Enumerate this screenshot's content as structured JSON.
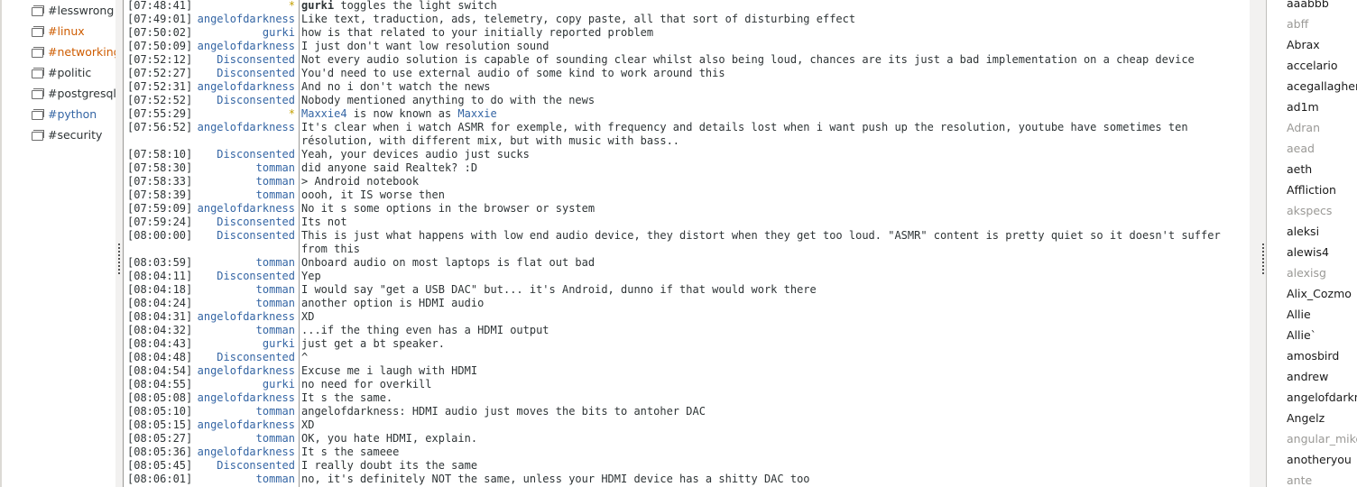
{
  "channels": [
    {
      "name": "#lesswrong",
      "state": "normal"
    },
    {
      "name": "#linux",
      "state": "highlight"
    },
    {
      "name": "#networking",
      "state": "highlight"
    },
    {
      "name": "#politic",
      "state": "normal"
    },
    {
      "name": "#postgresql",
      "state": "normal"
    },
    {
      "name": "#python",
      "state": "msg"
    },
    {
      "name": "#security",
      "state": "normal"
    }
  ],
  "messages": [
    {
      "time": "[07:48:41]",
      "nick": "*",
      "type": "action",
      "actor": "gurki",
      "text": " toggles the light switch"
    },
    {
      "time": "[07:49:01]",
      "nick": "angelofdarkness",
      "text": "Like text, traduction, ads, telemetry, copy paste, all that sort of disturbing effect"
    },
    {
      "time": "[07:50:02]",
      "nick": "gurki",
      "text": "how is that related to your initially reported problem"
    },
    {
      "time": "[07:50:09]",
      "nick": "angelofdarkness",
      "text": "I just don't want low resolution sound"
    },
    {
      "time": "[07:52:12]",
      "nick": "Disconsented",
      "text": "Not every audio solution is capable of sounding clear whilst also being loud, chances are its just a bad implementation on a cheap device"
    },
    {
      "time": "[07:52:27]",
      "nick": "Disconsented",
      "text": "You'd need to use external audio of some kind to work around this"
    },
    {
      "time": "[07:52:31]",
      "nick": "angelofdarkness",
      "text": "And no i don't watch the news"
    },
    {
      "time": "[07:52:52]",
      "nick": "Disconsented",
      "text": "Nobody mentioned anything to do with the news"
    },
    {
      "time": "[07:55:29]",
      "nick": "*",
      "type": "nickchange",
      "old": "Maxxie4",
      "mid": " is now known as ",
      "new": "Maxxie"
    },
    {
      "time": "[07:56:52]",
      "nick": "angelofdarkness",
      "text": "It's clear when i watch ASMR for exemple, with frequency and details lost when i want push up the resolution, youtube have sometimes ten résolution, with different mix, but with music with bass.."
    },
    {
      "time": "[07:58:10]",
      "nick": "Disconsented",
      "text": "Yeah, your devices audio just sucks"
    },
    {
      "time": "[07:58:30]",
      "nick": "tomman",
      "text": "did anyone said Realtek? :D"
    },
    {
      "time": "[07:58:33]",
      "nick": "tomman",
      "text": "> Android notebook"
    },
    {
      "time": "[07:58:39]",
      "nick": "tomman",
      "text": "oooh, it IS worse then"
    },
    {
      "time": "[07:59:09]",
      "nick": "angelofdarkness",
      "text": "No it s some options in the browser or system"
    },
    {
      "time": "[07:59:24]",
      "nick": "Disconsented",
      "text": "Its not"
    },
    {
      "time": "[08:00:00]",
      "nick": "Disconsented",
      "text": "This is just what happens with low end audio device, they distort when they get too loud. \"ASMR\" content is pretty quiet so it doesn't suffer from this"
    },
    {
      "time": "[08:03:59]",
      "nick": "tomman",
      "text": "Onboard audio on most laptops is flat out bad"
    },
    {
      "time": "[08:04:11]",
      "nick": "Disconsented",
      "text": "Yep"
    },
    {
      "time": "[08:04:18]",
      "nick": "tomman",
      "text": "I would say \"get a USB DAC\" but... it's Android, dunno if that would work there"
    },
    {
      "time": "[08:04:24]",
      "nick": "tomman",
      "text": "another option is HDMI audio"
    },
    {
      "time": "[08:04:31]",
      "nick": "angelofdarkness",
      "text": "XD"
    },
    {
      "time": "[08:04:32]",
      "nick": "tomman",
      "text": "...if the thing even has a HDMI output"
    },
    {
      "time": "[08:04:43]",
      "nick": "gurki",
      "text": "just get a bt speaker."
    },
    {
      "time": "[08:04:48]",
      "nick": "Disconsented",
      "text": "^"
    },
    {
      "time": "[08:04:54]",
      "nick": "angelofdarkness",
      "text": "Excuse me i laugh with HDMI"
    },
    {
      "time": "[08:04:55]",
      "nick": "gurki",
      "text": "no need for overkill"
    },
    {
      "time": "[08:05:08]",
      "nick": "angelofdarkness",
      "text": "It s the same."
    },
    {
      "time": "[08:05:10]",
      "nick": "tomman",
      "text": "angelofdarkness: HDMI audio just moves the bits to antoher DAC"
    },
    {
      "time": "[08:05:15]",
      "nick": "angelofdarkness",
      "text": "XD"
    },
    {
      "time": "[08:05:27]",
      "nick": "tomman",
      "text": "OK, you hate HDMI, explain."
    },
    {
      "time": "[08:05:36]",
      "nick": "angelofdarkness",
      "text": "It s the sameee"
    },
    {
      "time": "[08:05:45]",
      "nick": "Disconsented",
      "text": "I really doubt its the same"
    },
    {
      "time": "[08:06:01]",
      "nick": "tomman",
      "text": "no, it's definitely NOT the same, unless your HDMI device has a shitty DAC too"
    }
  ],
  "users": [
    {
      "name": "aaabbb",
      "away": false
    },
    {
      "name": "abff",
      "away": true
    },
    {
      "name": "Abrax",
      "away": false
    },
    {
      "name": "accelario",
      "away": false
    },
    {
      "name": "acegallagher",
      "away": false
    },
    {
      "name": "ad1m",
      "away": false
    },
    {
      "name": "Adran",
      "away": true
    },
    {
      "name": "aead",
      "away": true
    },
    {
      "name": "aeth",
      "away": false
    },
    {
      "name": "Affliction",
      "away": false
    },
    {
      "name": "akspecs",
      "away": true
    },
    {
      "name": "aleksi",
      "away": false
    },
    {
      "name": "alewis4",
      "away": false
    },
    {
      "name": "alexisg",
      "away": true
    },
    {
      "name": "Alix_Cozmo",
      "away": false
    },
    {
      "name": "Allie",
      "away": false
    },
    {
      "name": "Allie`",
      "away": false
    },
    {
      "name": "amosbird",
      "away": false
    },
    {
      "name": "andrew",
      "away": false
    },
    {
      "name": "angelofdarkness",
      "away": false
    },
    {
      "name": "Angelz",
      "away": false
    },
    {
      "name": "angular_mike",
      "away": true
    },
    {
      "name": "anotheryou",
      "away": false
    },
    {
      "name": "ante",
      "away": true
    }
  ]
}
